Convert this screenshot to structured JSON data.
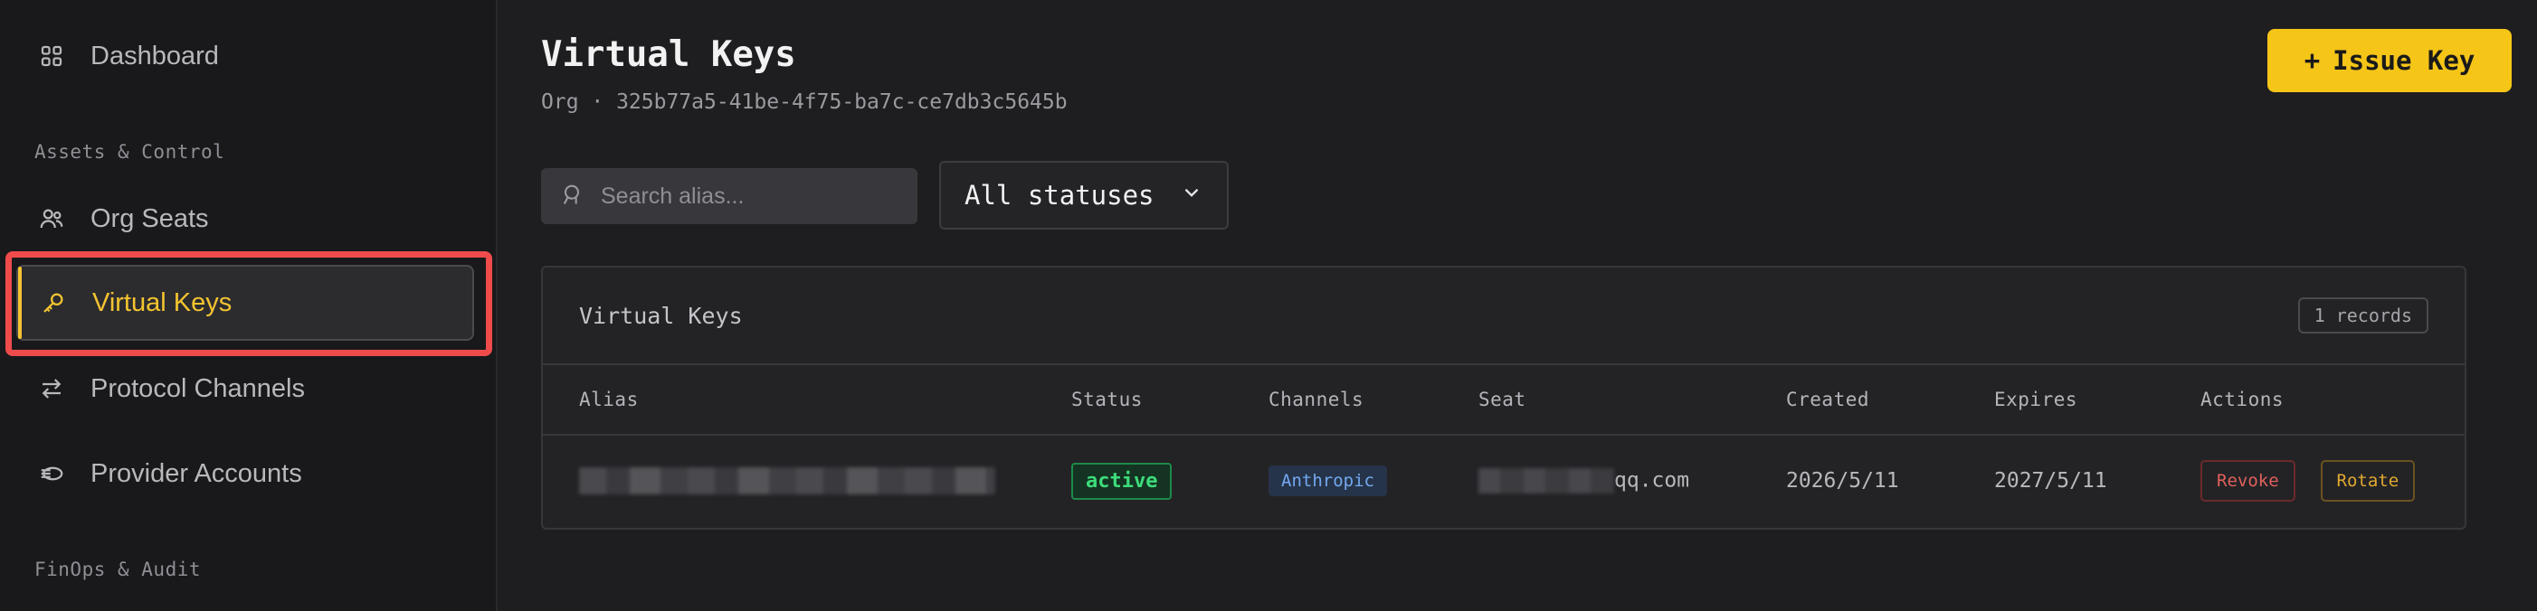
{
  "sidebar": {
    "dashboard": "Dashboard",
    "section_assets": "Assets & Control",
    "org_seats": "Org Seats",
    "virtual_keys": "Virtual Keys",
    "protocol_channels": "Protocol Channels",
    "provider_accounts": "Provider Accounts",
    "section_finops": "FinOps & Audit"
  },
  "header": {
    "title": "Virtual Keys",
    "org_line": "Org · 325b77a5-41be-4f75-ba7c-ce7db3c5645b",
    "issue_button": "Issue Key",
    "issue_icon": "+"
  },
  "filters": {
    "search_placeholder": "Search alias...",
    "status_value": "All statuses"
  },
  "table": {
    "title": "Virtual Keys",
    "records": "1 records",
    "columns": [
      "Alias",
      "Status",
      "Channels",
      "Seat",
      "Created",
      "Expires",
      "Actions"
    ],
    "rows": [
      {
        "status": "active",
        "channel": "Anthropic",
        "seat_suffix": "qq.com",
        "created": "2026/5/11",
        "expires": "2027/5/11",
        "revoke": "Revoke",
        "rotate": "Rotate"
      }
    ]
  },
  "colors": {
    "accent": "#f5c518",
    "highlight_outline": "#f04b4b",
    "active_status": "#3ddc7a",
    "channel": "#74a8f0"
  }
}
